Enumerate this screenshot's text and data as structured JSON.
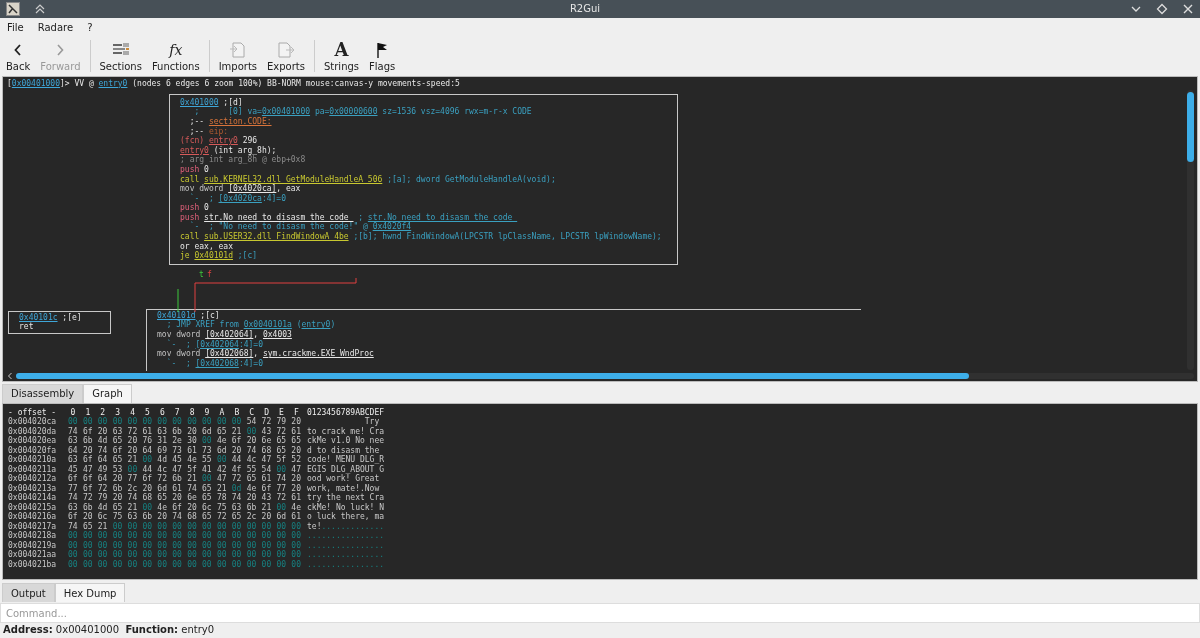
{
  "window": {
    "title": "R2Gui"
  },
  "menu": [
    "File",
    "Radare",
    "?"
  ],
  "toolbar": {
    "groups": [
      {
        "items": [
          {
            "label": "Back",
            "kind": "back",
            "disabled": false
          },
          {
            "label": "Forward",
            "kind": "forward",
            "disabled": true
          }
        ]
      },
      {
        "items": [
          {
            "label": "Sections",
            "kind": "sections",
            "disabled": false
          },
          {
            "label": "Functions",
            "kind": "functions",
            "glyph": "fx",
            "disabled": false
          }
        ]
      },
      {
        "items": [
          {
            "label": "Imports",
            "kind": "imports",
            "disabled": false
          },
          {
            "label": "Exports",
            "kind": "exports",
            "disabled": false
          }
        ]
      },
      {
        "items": [
          {
            "label": "Strings",
            "kind": "strings",
            "glyph": "A",
            "disabled": false
          },
          {
            "label": "Flags",
            "kind": "flags",
            "disabled": false
          }
        ]
      }
    ]
  },
  "graph": {
    "prompt": [
      {
        "text": "[",
        "kind": "plain"
      },
      {
        "text": "0x00401000",
        "kind": "addr"
      },
      {
        "text": "]> VV @ ",
        "kind": "plain"
      },
      {
        "text": "entry0",
        "kind": "addr"
      },
      {
        "text": " (nodes 6 edges 6 zoom 100%) BB-NORM mouse:canvas-y movements-speed:5",
        "kind": "plain"
      }
    ],
    "nodes": [
      {
        "lines": [
          [
            {
              "text": "0x401000",
              "kind": "addr"
            },
            {
              "text": " ;[d]",
              "kind": "plain"
            }
          ],
          [
            {
              "text": "   ;      [0] va=",
              "kind": "comment"
            },
            {
              "text": "0x00401000",
              "kind": "comment_ref"
            },
            {
              "text": " pa=",
              "kind": "comment"
            },
            {
              "text": "0x00000600",
              "kind": "comment_ref"
            },
            {
              "text": " sz=1536 vsz=4096 rwx=m-r-x CODE",
              "kind": "comment"
            }
          ],
          [
            {
              "text": "  ;-- ",
              "kind": "plain"
            },
            {
              "text": "section.CODE:",
              "kind": "flag"
            }
          ],
          [
            {
              "text": "  ;-- ",
              "kind": "plain"
            },
            {
              "text": "eip:",
              "kind": "flag_dim"
            }
          ],
          [
            {
              "text": "(fcn) ",
              "kind": "fcn"
            },
            {
              "text": "entry0",
              "kind": "fcn_ref"
            },
            {
              "text": " 296",
              "kind": "plain"
            }
          ],
          [
            {
              "text": "entry0",
              "kind": "fcn_ref"
            },
            {
              "text": " (int arg_8h);",
              "kind": "plain"
            }
          ],
          [
            {
              "text": "; arg int arg_8h @ ebp+0x8",
              "kind": "dim"
            }
          ],
          [
            {
              "text": "push",
              "kind": "push"
            },
            {
              "text": " 0",
              "kind": "plain"
            }
          ],
          [
            {
              "text": "call ",
              "kind": "call"
            },
            {
              "text": "sub.KERNEL32.dll_GetModuleHandleA_506",
              "kind": "call_ref"
            },
            {
              "text": " ;[a]; dword GetModuleHandleA(void);",
              "kind": "comment"
            }
          ],
          [
            {
              "text": "mov dword ",
              "kind": "mov"
            },
            {
              "text": "[0x4020ca]",
              "kind": "ref"
            },
            {
              "text": ", eax",
              "kind": "plain"
            }
          ],
          [
            {
              "text": "  `-  ; ",
              "kind": "comment"
            },
            {
              "text": "[0x4020ca",
              "kind": "comment_ref"
            },
            {
              "text": ":4]=0",
              "kind": "comment"
            }
          ],
          [
            {
              "text": "push",
              "kind": "push"
            },
            {
              "text": " 0",
              "kind": "plain"
            }
          ],
          [
            {
              "text": "push ",
              "kind": "push"
            },
            {
              "text": "str.No_need_to_disasm_the_code_",
              "kind": "ref"
            },
            {
              "text": " ; ",
              "kind": "comment"
            },
            {
              "text": "str.No_need_to_disasm_the_code_",
              "kind": "comment_ref"
            }
          ],
          [
            {
              "text": "  `-  ; \"No need to disasm the code!\" @ ",
              "kind": "comment"
            },
            {
              "text": "0x4020f4",
              "kind": "comment_ref"
            }
          ],
          [
            {
              "text": "call ",
              "kind": "call"
            },
            {
              "text": "sub.USER32.dll_FindWindowA_4be",
              "kind": "call_ref"
            },
            {
              "text": " ;[b]; hwnd FindWindowA(LPCSTR lpClassName, LPCSTR lpWindowName);",
              "kind": "comment"
            }
          ],
          [
            {
              "text": "or eax, eax",
              "kind": "plain"
            }
          ],
          [
            {
              "text": "je ",
              "kind": "call"
            },
            {
              "text": "0x40101d",
              "kind": "call_ref"
            },
            {
              "text": " ;[c]",
              "kind": "comment"
            }
          ]
        ]
      },
      {
        "lines": [
          [
            {
              "text": "0x40101c",
              "kind": "addr"
            },
            {
              "text": " ;[e]",
              "kind": "plain"
            }
          ],
          [
            {
              "text": "ret",
              "kind": "plain"
            }
          ]
        ]
      },
      {
        "lines": [
          [
            {
              "text": "0x40101d",
              "kind": "addr"
            },
            {
              "text": " ;[c]",
              "kind": "plain"
            }
          ],
          [
            {
              "text": "  ; JMP XREF from ",
              "kind": "comment"
            },
            {
              "text": "0x0040101a",
              "kind": "comment_ref"
            },
            {
              "text": " (",
              "kind": "comment"
            },
            {
              "text": "entry0",
              "kind": "comment_ref"
            },
            {
              "text": ")",
              "kind": "comment"
            }
          ],
          [
            {
              "text": "mov dword ",
              "kind": "mov"
            },
            {
              "text": "[0x402064]",
              "kind": "ref"
            },
            {
              "text": ", ",
              "kind": "plain"
            },
            {
              "text": "0x4003",
              "kind": "ref"
            }
          ],
          [
            {
              "text": "  `-  ; ",
              "kind": "comment"
            },
            {
              "text": "[0x402064",
              "kind": "comment_ref"
            },
            {
              "text": ":4]=0",
              "kind": "comment"
            }
          ],
          [
            {
              "text": "mov dword ",
              "kind": "mov"
            },
            {
              "text": "[0x402068]",
              "kind": "ref"
            },
            {
              "text": ", ",
              "kind": "plain"
            },
            {
              "text": "sym.crackme.EXE_WndProc",
              "kind": "ref"
            }
          ],
          [
            {
              "text": "  `-  ; ",
              "kind": "comment"
            },
            {
              "text": "[0x402068",
              "kind": "comment_ref"
            },
            {
              "text": ":4]=0",
              "kind": "comment"
            }
          ]
        ]
      }
    ],
    "edges": [
      {
        "label": "t",
        "kind": "true"
      },
      {
        "label": "f",
        "kind": "false"
      }
    ]
  },
  "view_tabs": [
    {
      "label": "Disassembly",
      "selected": false
    },
    {
      "label": "Graph",
      "selected": true
    }
  ],
  "hexdump": {
    "header": {
      "offset": "- offset -",
      "columns": [
        "0",
        "1",
        "2",
        "3",
        "4",
        "5",
        "6",
        "7",
        "8",
        "9",
        "A",
        "B",
        "C",
        "D",
        "E",
        "F"
      ],
      "ascii": "0123456789ABCDEF"
    },
    "rows": [
      {
        "offset": "0x004020ca",
        "bytes": [
          {
            "hex": "00",
            "printable": false
          },
          {
            "hex": "00",
            "printable": false
          },
          {
            "hex": "00",
            "printable": false
          },
          {
            "hex": "00",
            "printable": false
          },
          {
            "hex": "00",
            "printable": false
          },
          {
            "hex": "00",
            "printable": false
          },
          {
            "hex": "00",
            "printable": false
          },
          {
            "hex": "00",
            "printable": false
          },
          {
            "hex": "00",
            "printable": false
          },
          {
            "hex": "00",
            "printable": false
          },
          {
            "hex": "00",
            "printable": false
          },
          {
            "hex": "00",
            "printable": false
          },
          {
            "hex": "54",
            "printable": true
          },
          {
            "hex": "72",
            "printable": true
          },
          {
            "hex": "79",
            "printable": true
          },
          {
            "hex": "20",
            "printable": true
          }
        ],
        "ascii": [
          {
            "text": "            Try",
            "printable": true
          }
        ]
      },
      {
        "offset": "0x004020da",
        "bytes": [
          {
            "hex": "74",
            "printable": true
          },
          {
            "hex": "6f",
            "printable": true
          },
          {
            "hex": "20",
            "printable": true
          },
          {
            "hex": "63",
            "printable": true
          },
          {
            "hex": "72",
            "printable": true
          },
          {
            "hex": "61",
            "printable": true
          },
          {
            "hex": "63",
            "printable": true
          },
          {
            "hex": "6b",
            "printable": true
          },
          {
            "hex": "20",
            "printable": true
          },
          {
            "hex": "6d",
            "printable": true
          },
          {
            "hex": "65",
            "printable": true
          },
          {
            "hex": "21",
            "printable": true
          },
          {
            "hex": "00",
            "printable": false
          },
          {
            "hex": "43",
            "printable": true
          },
          {
            "hex": "72",
            "printable": true
          },
          {
            "hex": "61",
            "printable": true
          }
        ],
        "ascii": [
          {
            "text": "to crack me! Cra",
            "printable": true
          }
        ]
      },
      {
        "offset": "0x004020ea",
        "bytes": [
          {
            "hex": "63",
            "printable": true
          },
          {
            "hex": "6b",
            "printable": true
          },
          {
            "hex": "4d",
            "printable": true
          },
          {
            "hex": "65",
            "printable": true
          },
          {
            "hex": "20",
            "printable": true
          },
          {
            "hex": "76",
            "printable": true
          },
          {
            "hex": "31",
            "printable": true
          },
          {
            "hex": "2e",
            "printable": true
          },
          {
            "hex": "30",
            "printable": true
          },
          {
            "hex": "00",
            "printable": false
          },
          {
            "hex": "4e",
            "printable": true
          },
          {
            "hex": "6f",
            "printable": true
          },
          {
            "hex": "20",
            "printable": true
          },
          {
            "hex": "6e",
            "printable": true
          },
          {
            "hex": "65",
            "printable": true
          },
          {
            "hex": "65",
            "printable": true
          }
        ],
        "ascii": [
          {
            "text": "ckMe v1.0 No nee",
            "printable": true
          }
        ]
      },
      {
        "offset": "0x004020fa",
        "bytes": [
          {
            "hex": "64",
            "printable": true
          },
          {
            "hex": "20",
            "printable": true
          },
          {
            "hex": "74",
            "printable": true
          },
          {
            "hex": "6f",
            "printable": true
          },
          {
            "hex": "20",
            "printable": true
          },
          {
            "hex": "64",
            "printable": true
          },
          {
            "hex": "69",
            "printable": true
          },
          {
            "hex": "73",
            "printable": true
          },
          {
            "hex": "61",
            "printable": true
          },
          {
            "hex": "73",
            "printable": true
          },
          {
            "hex": "6d",
            "printable": true
          },
          {
            "hex": "20",
            "printable": true
          },
          {
            "hex": "74",
            "printable": true
          },
          {
            "hex": "68",
            "printable": true
          },
          {
            "hex": "65",
            "printable": true
          },
          {
            "hex": "20",
            "printable": true
          }
        ],
        "ascii": [
          {
            "text": "d to disasm the",
            "printable": true
          }
        ]
      },
      {
        "offset": "0x0040210a",
        "bytes": [
          {
            "hex": "63",
            "printable": true
          },
          {
            "hex": "6f",
            "printable": true
          },
          {
            "hex": "64",
            "printable": true
          },
          {
            "hex": "65",
            "printable": true
          },
          {
            "hex": "21",
            "printable": true
          },
          {
            "hex": "00",
            "printable": false
          },
          {
            "hex": "4d",
            "printable": true
          },
          {
            "hex": "45",
            "printable": true
          },
          {
            "hex": "4e",
            "printable": true
          },
          {
            "hex": "55",
            "printable": true
          },
          {
            "hex": "00",
            "printable": false
          },
          {
            "hex": "44",
            "printable": true
          },
          {
            "hex": "4c",
            "printable": true
          },
          {
            "hex": "47",
            "printable": true
          },
          {
            "hex": "5f",
            "printable": true
          },
          {
            "hex": "52",
            "printable": true
          }
        ],
        "ascii": [
          {
            "text": "code! MENU DLG_R",
            "printable": true
          }
        ]
      },
      {
        "offset": "0x0040211a",
        "bytes": [
          {
            "hex": "45",
            "printable": true
          },
          {
            "hex": "47",
            "printable": true
          },
          {
            "hex": "49",
            "printable": true
          },
          {
            "hex": "53",
            "printable": true
          },
          {
            "hex": "00",
            "printable": false
          },
          {
            "hex": "44",
            "printable": true
          },
          {
            "hex": "4c",
            "printable": true
          },
          {
            "hex": "47",
            "printable": true
          },
          {
            "hex": "5f",
            "printable": true
          },
          {
            "hex": "41",
            "printable": true
          },
          {
            "hex": "42",
            "printable": true
          },
          {
            "hex": "4f",
            "printable": true
          },
          {
            "hex": "55",
            "printable": true
          },
          {
            "hex": "54",
            "printable": true
          },
          {
            "hex": "00",
            "printable": false
          },
          {
            "hex": "47",
            "printable": true
          }
        ],
        "ascii": [
          {
            "text": "EGIS DLG_ABOUT G",
            "printable": true
          }
        ]
      },
      {
        "offset": "0x0040212a",
        "bytes": [
          {
            "hex": "6f",
            "printable": true
          },
          {
            "hex": "6f",
            "printable": true
          },
          {
            "hex": "64",
            "printable": true
          },
          {
            "hex": "20",
            "printable": true
          },
          {
            "hex": "77",
            "printable": true
          },
          {
            "hex": "6f",
            "printable": true
          },
          {
            "hex": "72",
            "printable": true
          },
          {
            "hex": "6b",
            "printable": true
          },
          {
            "hex": "21",
            "printable": true
          },
          {
            "hex": "00",
            "printable": false
          },
          {
            "hex": "47",
            "printable": true
          },
          {
            "hex": "72",
            "printable": true
          },
          {
            "hex": "65",
            "printable": true
          },
          {
            "hex": "61",
            "printable": true
          },
          {
            "hex": "74",
            "printable": true
          },
          {
            "hex": "20",
            "printable": true
          }
        ],
        "ascii": [
          {
            "text": "ood work! Great",
            "printable": true
          }
        ]
      },
      {
        "offset": "0x0040213a",
        "bytes": [
          {
            "hex": "77",
            "printable": true
          },
          {
            "hex": "6f",
            "printable": true
          },
          {
            "hex": "72",
            "printable": true
          },
          {
            "hex": "6b",
            "printable": true
          },
          {
            "hex": "2c",
            "printable": true
          },
          {
            "hex": "20",
            "printable": true
          },
          {
            "hex": "6d",
            "printable": true
          },
          {
            "hex": "61",
            "printable": true
          },
          {
            "hex": "74",
            "printable": true
          },
          {
            "hex": "65",
            "printable": true
          },
          {
            "hex": "21",
            "printable": true
          },
          {
            "hex": "0d",
            "printable": false
          },
          {
            "hex": "4e",
            "printable": true
          },
          {
            "hex": "6f",
            "printable": true
          },
          {
            "hex": "77",
            "printable": true
          },
          {
            "hex": "20",
            "printable": true
          }
        ],
        "ascii": [
          {
            "text": "work, mate!.Now",
            "printable": true
          }
        ]
      },
      {
        "offset": "0x0040214a",
        "bytes": [
          {
            "hex": "74",
            "printable": true
          },
          {
            "hex": "72",
            "printable": true
          },
          {
            "hex": "79",
            "printable": true
          },
          {
            "hex": "20",
            "printable": true
          },
          {
            "hex": "74",
            "printable": true
          },
          {
            "hex": "68",
            "printable": true
          },
          {
            "hex": "65",
            "printable": true
          },
          {
            "hex": "20",
            "printable": true
          },
          {
            "hex": "6e",
            "printable": true
          },
          {
            "hex": "65",
            "printable": true
          },
          {
            "hex": "78",
            "printable": true
          },
          {
            "hex": "74",
            "printable": true
          },
          {
            "hex": "20",
            "printable": true
          },
          {
            "hex": "43",
            "printable": true
          },
          {
            "hex": "72",
            "printable": true
          },
          {
            "hex": "61",
            "printable": true
          }
        ],
        "ascii": [
          {
            "text": "try the next Cra",
            "printable": true
          }
        ]
      },
      {
        "offset": "0x0040215a",
        "bytes": [
          {
            "hex": "63",
            "printable": true
          },
          {
            "hex": "6b",
            "printable": true
          },
          {
            "hex": "4d",
            "printable": true
          },
          {
            "hex": "65",
            "printable": true
          },
          {
            "hex": "21",
            "printable": true
          },
          {
            "hex": "00",
            "printable": false
          },
          {
            "hex": "4e",
            "printable": true
          },
          {
            "hex": "6f",
            "printable": true
          },
          {
            "hex": "20",
            "printable": true
          },
          {
            "hex": "6c",
            "printable": true
          },
          {
            "hex": "75",
            "printable": true
          },
          {
            "hex": "63",
            "printable": true
          },
          {
            "hex": "6b",
            "printable": true
          },
          {
            "hex": "21",
            "printable": true
          },
          {
            "hex": "00",
            "printable": false
          },
          {
            "hex": "4e",
            "printable": true
          }
        ],
        "ascii": [
          {
            "text": "ckMe! No luck! N",
            "printable": true
          }
        ]
      },
      {
        "offset": "0x0040216a",
        "bytes": [
          {
            "hex": "6f",
            "printable": true
          },
          {
            "hex": "20",
            "printable": true
          },
          {
            "hex": "6c",
            "printable": true
          },
          {
            "hex": "75",
            "printable": true
          },
          {
            "hex": "63",
            "printable": true
          },
          {
            "hex": "6b",
            "printable": true
          },
          {
            "hex": "20",
            "printable": true
          },
          {
            "hex": "74",
            "printable": true
          },
          {
            "hex": "68",
            "printable": true
          },
          {
            "hex": "65",
            "printable": true
          },
          {
            "hex": "72",
            "printable": true
          },
          {
            "hex": "65",
            "printable": true
          },
          {
            "hex": "2c",
            "printable": true
          },
          {
            "hex": "20",
            "printable": true
          },
          {
            "hex": "6d",
            "printable": true
          },
          {
            "hex": "61",
            "printable": true
          }
        ],
        "ascii": [
          {
            "text": "o luck there, ma",
            "printable": true
          }
        ]
      },
      {
        "offset": "0x0040217a",
        "bytes": [
          {
            "hex": "74",
            "printable": true
          },
          {
            "hex": "65",
            "printable": true
          },
          {
            "hex": "21",
            "printable": true
          },
          {
            "hex": "00",
            "printable": false
          },
          {
            "hex": "00",
            "printable": false
          },
          {
            "hex": "00",
            "printable": false
          },
          {
            "hex": "00",
            "printable": false
          },
          {
            "hex": "00",
            "printable": false
          },
          {
            "hex": "00",
            "printable": false
          },
          {
            "hex": "00",
            "printable": false
          },
          {
            "hex": "00",
            "printable": false
          },
          {
            "hex": "00",
            "printable": false
          },
          {
            "hex": "00",
            "printable": false
          },
          {
            "hex": "00",
            "printable": false
          },
          {
            "hex": "00",
            "printable": false
          },
          {
            "hex": "00",
            "printable": false
          }
        ],
        "ascii": [
          {
            "text": "te!",
            "printable": true
          },
          {
            "text": ".............",
            "printable": false
          }
        ]
      },
      {
        "offset": "0x0040218a",
        "bytes": [
          {
            "hex": "00",
            "printable": false
          },
          {
            "hex": "00",
            "printable": false
          },
          {
            "hex": "00",
            "printable": false
          },
          {
            "hex": "00",
            "printable": false
          },
          {
            "hex": "00",
            "printable": false
          },
          {
            "hex": "00",
            "printable": false
          },
          {
            "hex": "00",
            "printable": false
          },
          {
            "hex": "00",
            "printable": false
          },
          {
            "hex": "00",
            "printable": false
          },
          {
            "hex": "00",
            "printable": false
          },
          {
            "hex": "00",
            "printable": false
          },
          {
            "hex": "00",
            "printable": false
          },
          {
            "hex": "00",
            "printable": false
          },
          {
            "hex": "00",
            "printable": false
          },
          {
            "hex": "00",
            "printable": false
          },
          {
            "hex": "00",
            "printable": false
          }
        ],
        "ascii": [
          {
            "text": "................",
            "printable": false
          }
        ]
      },
      {
        "offset": "0x0040219a",
        "bytes": [
          {
            "hex": "00",
            "printable": false
          },
          {
            "hex": "00",
            "printable": false
          },
          {
            "hex": "00",
            "printable": false
          },
          {
            "hex": "00",
            "printable": false
          },
          {
            "hex": "00",
            "printable": false
          },
          {
            "hex": "00",
            "printable": false
          },
          {
            "hex": "00",
            "printable": false
          },
          {
            "hex": "00",
            "printable": false
          },
          {
            "hex": "00",
            "printable": false
          },
          {
            "hex": "00",
            "printable": false
          },
          {
            "hex": "00",
            "printable": false
          },
          {
            "hex": "00",
            "printable": false
          },
          {
            "hex": "00",
            "printable": false
          },
          {
            "hex": "00",
            "printable": false
          },
          {
            "hex": "00",
            "printable": false
          },
          {
            "hex": "00",
            "printable": false
          }
        ],
        "ascii": [
          {
            "text": "................",
            "printable": false
          }
        ]
      },
      {
        "offset": "0x004021aa",
        "bytes": [
          {
            "hex": "00",
            "printable": false
          },
          {
            "hex": "00",
            "printable": false
          },
          {
            "hex": "00",
            "printable": false
          },
          {
            "hex": "00",
            "printable": false
          },
          {
            "hex": "00",
            "printable": false
          },
          {
            "hex": "00",
            "printable": false
          },
          {
            "hex": "00",
            "printable": false
          },
          {
            "hex": "00",
            "printable": false
          },
          {
            "hex": "00",
            "printable": false
          },
          {
            "hex": "00",
            "printable": false
          },
          {
            "hex": "00",
            "printable": false
          },
          {
            "hex": "00",
            "printable": false
          },
          {
            "hex": "00",
            "printable": false
          },
          {
            "hex": "00",
            "printable": false
          },
          {
            "hex": "00",
            "printable": false
          },
          {
            "hex": "00",
            "printable": false
          }
        ],
        "ascii": [
          {
            "text": "................",
            "printable": false
          }
        ]
      },
      {
        "offset": "0x004021ba",
        "bytes": [
          {
            "hex": "00",
            "printable": false
          },
          {
            "hex": "00",
            "printable": false
          },
          {
            "hex": "00",
            "printable": false
          },
          {
            "hex": "00",
            "printable": false
          },
          {
            "hex": "00",
            "printable": false
          },
          {
            "hex": "00",
            "printable": false
          },
          {
            "hex": "00",
            "printable": false
          },
          {
            "hex": "00",
            "printable": false
          },
          {
            "hex": "00",
            "printable": false
          },
          {
            "hex": "00",
            "printable": false
          },
          {
            "hex": "00",
            "printable": false
          },
          {
            "hex": "00",
            "printable": false
          },
          {
            "hex": "00",
            "printable": false
          },
          {
            "hex": "00",
            "printable": false
          },
          {
            "hex": "00",
            "printable": false
          },
          {
            "hex": "00",
            "printable": false
          }
        ],
        "ascii": [
          {
            "text": "................",
            "printable": false
          }
        ]
      }
    ]
  },
  "output_tabs": [
    {
      "label": "Output",
      "selected": false
    },
    {
      "label": "Hex Dump",
      "selected": true
    }
  ],
  "command": {
    "placeholder": "Command..."
  },
  "status_bar": "**Address:** 0x00401000  **Function:** entry0"
}
